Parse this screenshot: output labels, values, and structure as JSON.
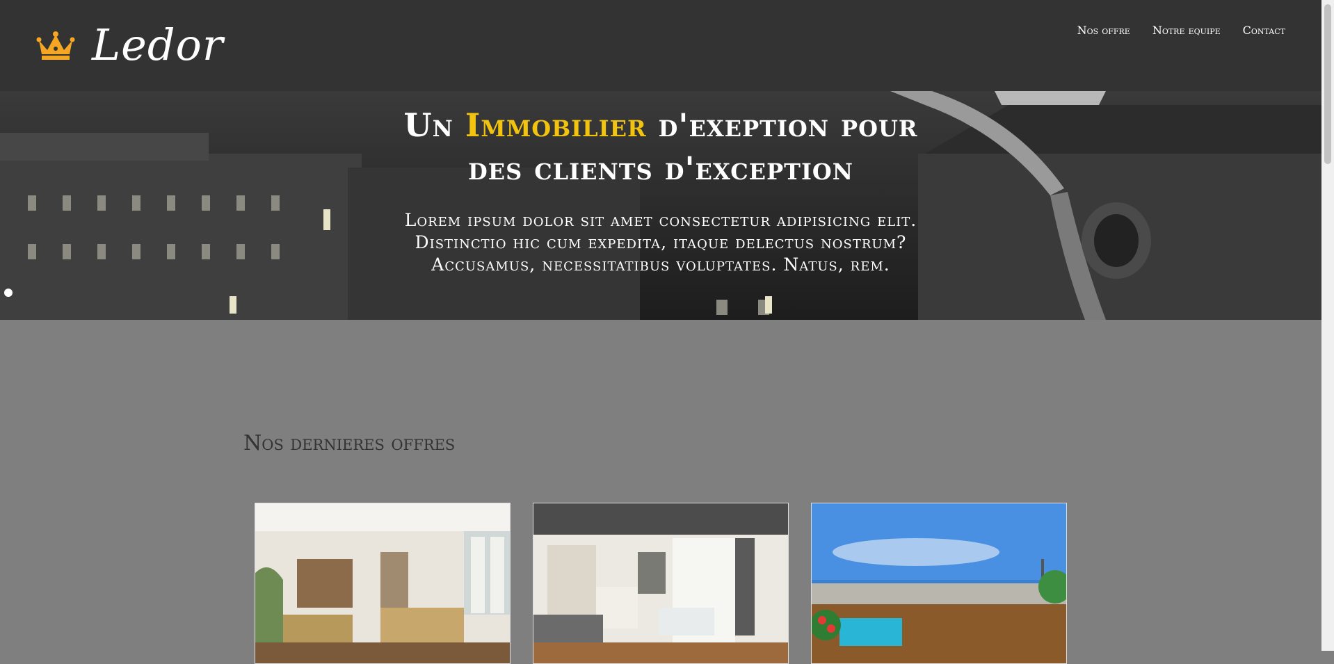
{
  "header": {
    "brand": "Ledor",
    "logo_icon": "crown-icon",
    "nav": [
      {
        "label": "Nos offre"
      },
      {
        "label": "Notre equipe"
      },
      {
        "label": "Contact"
      }
    ]
  },
  "hero": {
    "title_part1": "Un ",
    "title_accent": "Immobilier",
    "title_part2": " d'exeption pour",
    "title_line2": "des clients d'exception",
    "text": "Lorem ipsum dolor sit amet consectetur adipisicing elit. Distinctio hic cum expedita, itaque delectus nostrum? Accusamus, necessitatibus voluptates. Natus, rem."
  },
  "offers": {
    "title": "Nos dernieres offres",
    "cards": [
      {
        "image": "living-room-photo"
      },
      {
        "image": "apartment-interior-photo"
      },
      {
        "image": "rooftop-terrace-photo"
      }
    ]
  },
  "colors": {
    "header_bg": "#333333",
    "page_bg": "#7f7f7f",
    "accent": "#f2c40f",
    "crown": "#f5a623"
  }
}
